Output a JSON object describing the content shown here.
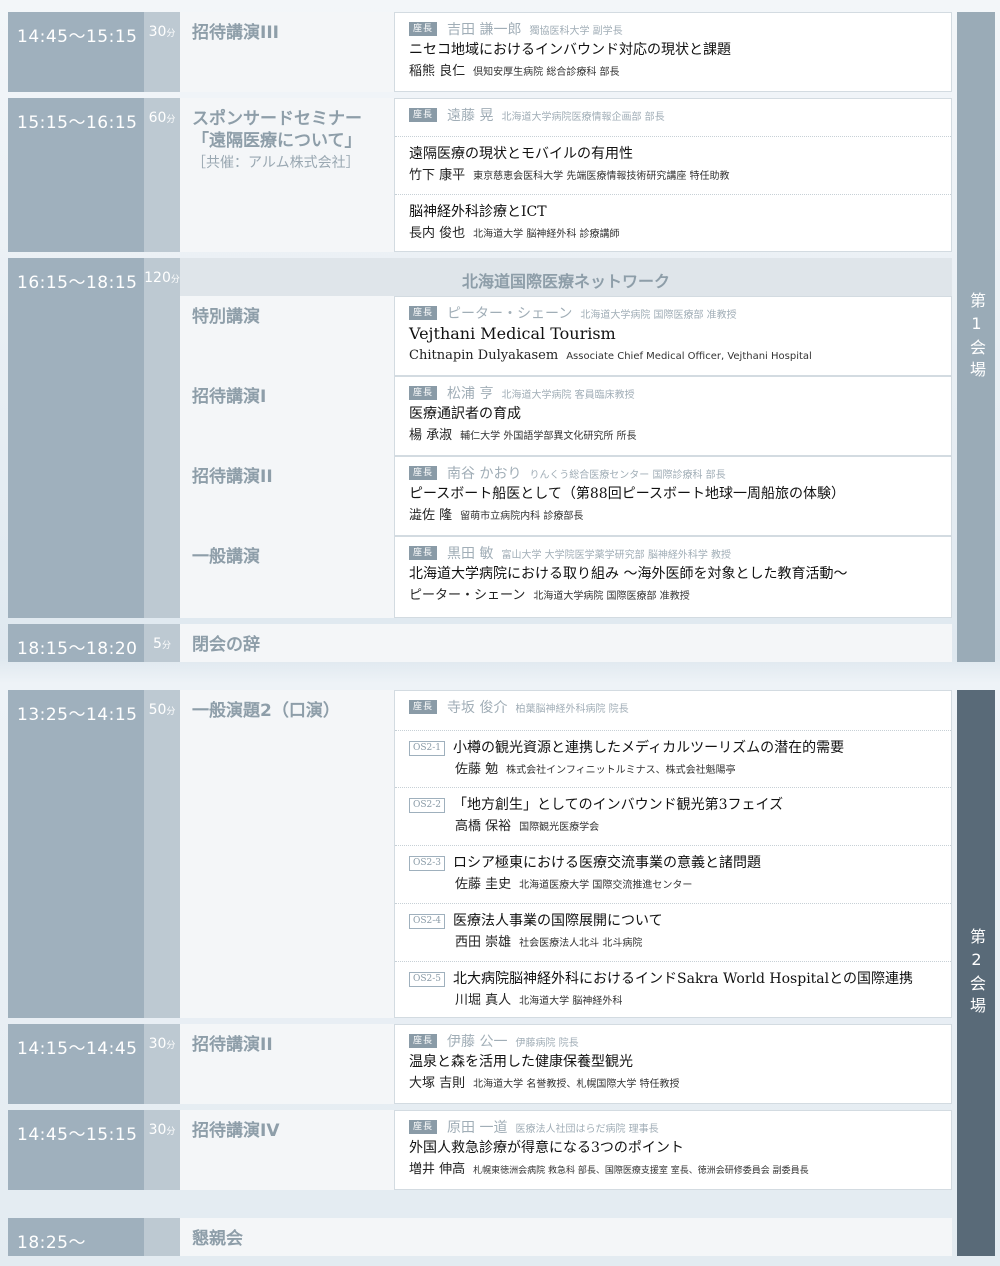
{
  "rooms": [
    "第1会場",
    "第2会場"
  ],
  "sessions": [
    {
      "time": "14:45〜15:15",
      "dur": "30",
      "unit": "分",
      "title": "招待講演III",
      "sub": "",
      "chair": {
        "label": "座長",
        "name": "吉田 謙一郎",
        "aff": "獨協医科大学 副学長"
      },
      "items": [
        {
          "title": "ニセコ地域におけるインバウンド対応の現状と課題",
          "name": "稲熊 良仁",
          "aff": "倶知安厚生病院 総合診療科 部長"
        }
      ]
    },
    {
      "time": "15:15〜16:15",
      "dur": "60",
      "unit": "分",
      "title": "スポンサードセミナー",
      "sub1": "「遠隔医療について」",
      "sub2": "［共催：アルム株式会社］",
      "chair": {
        "label": "座長",
        "name": "遠藤 晃",
        "aff": "北海道大学病院医療情報企画部 部長"
      },
      "items": [
        {
          "title": "遠隔医療の現状とモバイルの有用性",
          "name": "竹下 康平",
          "aff": "東京慈恵会医科大学 先端医療情報技術研究講座 特任助教"
        },
        {
          "title": "脳神経外科診療とICT",
          "name": "長内 俊也",
          "aff": "北海道大学 脳神経外科 診療講師"
        }
      ]
    },
    {
      "time": "16:15〜18:15",
      "dur": "120",
      "unit": "分",
      "header": "北海道国際医療ネットワーク",
      "subs": [
        {
          "title": "特別講演",
          "chair": {
            "label": "座長",
            "name": "ピーター・シェーン",
            "aff": "北海道大学病院 国際医療部 准教授"
          },
          "item": {
            "title": "Vejthani Medical Tourism",
            "name": "Chitnapin Dulyakasem",
            "aff": "Associate Chief Medical Officer, Vejthani Hospital"
          }
        },
        {
          "title": "招待講演I",
          "chair": {
            "label": "座長",
            "name": "松浦 亨",
            "aff": "北海道大学病院 客員臨床教授"
          },
          "item": {
            "title": "医療通訳者の育成",
            "name": "楊 承淑",
            "aff": "輔仁大学 外国語学部異文化研究所 所長"
          }
        },
        {
          "title": "招待講演II",
          "chair": {
            "label": "座長",
            "name": "南谷 かおり",
            "aff": "りんくう総合医療センター 国際診療科 部長"
          },
          "item": {
            "title": "ピースボート船医として（第88回ピースボート地球一周船旅の体験）",
            "name": "澁佐 隆",
            "aff": "留萌市立病院内科 診療部長"
          }
        },
        {
          "title": "一般講演",
          "chair": {
            "label": "座長",
            "name": "黒田 敏",
            "aff": "富山大学 大学院医学薬学研究部 脳神経外科学 教授"
          },
          "item": {
            "title": "北海道大学病院における取り組み 〜海外医師を対象とした教育活動〜",
            "name": "ピーター・シェーン",
            "aff": "北海道大学病院 国際医療部 准教授"
          }
        }
      ]
    },
    {
      "time": "18:15〜18:20",
      "dur": "5",
      "unit": "分",
      "title": "閉会の辞"
    },
    {
      "time": "13:25〜14:15",
      "dur": "50",
      "unit": "分",
      "title": "一般演題2（口演）",
      "chair": {
        "label": "座長",
        "name": "寺坂 俊介",
        "aff": "柏葉脳神経外科病院 院長"
      },
      "items": [
        {
          "code": "OS2-1",
          "title": "小樽の観光資源と連携したメディカルツーリズムの潜在的需要",
          "name": "佐藤 勉",
          "aff": "株式会社インフィニットルミナス、株式会社魁陽亭"
        },
        {
          "code": "OS2-2",
          "title": "「地方創生」としてのインバウンド観光第3フェイズ",
          "name": "高橋 保裕",
          "aff": "国際観光医療学会"
        },
        {
          "code": "OS2-3",
          "title": "ロシア極東における医療交流事業の意義と諸問題",
          "name": "佐藤 圭史",
          "aff": "北海道医療大学 国際交流推進センター"
        },
        {
          "code": "OS2-4",
          "title": "医療法人事業の国際展開について",
          "name": "西田 崇雄",
          "aff": "社会医療法人北斗 北斗病院"
        },
        {
          "code": "OS2-5",
          "title": "北大病院脳神経外科におけるインドSakra World Hospitalとの国際連携",
          "name": "川堀 真人",
          "aff": "北海道大学 脳神経外科"
        }
      ]
    },
    {
      "time": "14:15〜14:45",
      "dur": "30",
      "unit": "分",
      "title": "招待講演II",
      "chair": {
        "label": "座長",
        "name": "伊藤 公一",
        "aff": "伊藤病院 院長"
      },
      "items": [
        {
          "title": "温泉と森を活用した健康保養型観光",
          "name": "大塚 吉則",
          "aff": "北海道大学 名誉教授、札幌国際大学 特任教授"
        }
      ]
    },
    {
      "time": "14:45〜15:15",
      "dur": "30",
      "unit": "分",
      "title": "招待講演IV",
      "chair": {
        "label": "座長",
        "name": "原田 一道",
        "aff": "医療法人社団はらだ病院 理事長"
      },
      "items": [
        {
          "title": "外国人救急診療が得意になる3つのポイント",
          "name": "増井 伸高",
          "aff": "札幌東徳洲会病院 救急科 部長、国際医療支援室 室長、徳洲会研修委員会 副委員長"
        }
      ]
    },
    {
      "time": "18:25〜",
      "title": "懇親会"
    }
  ]
}
